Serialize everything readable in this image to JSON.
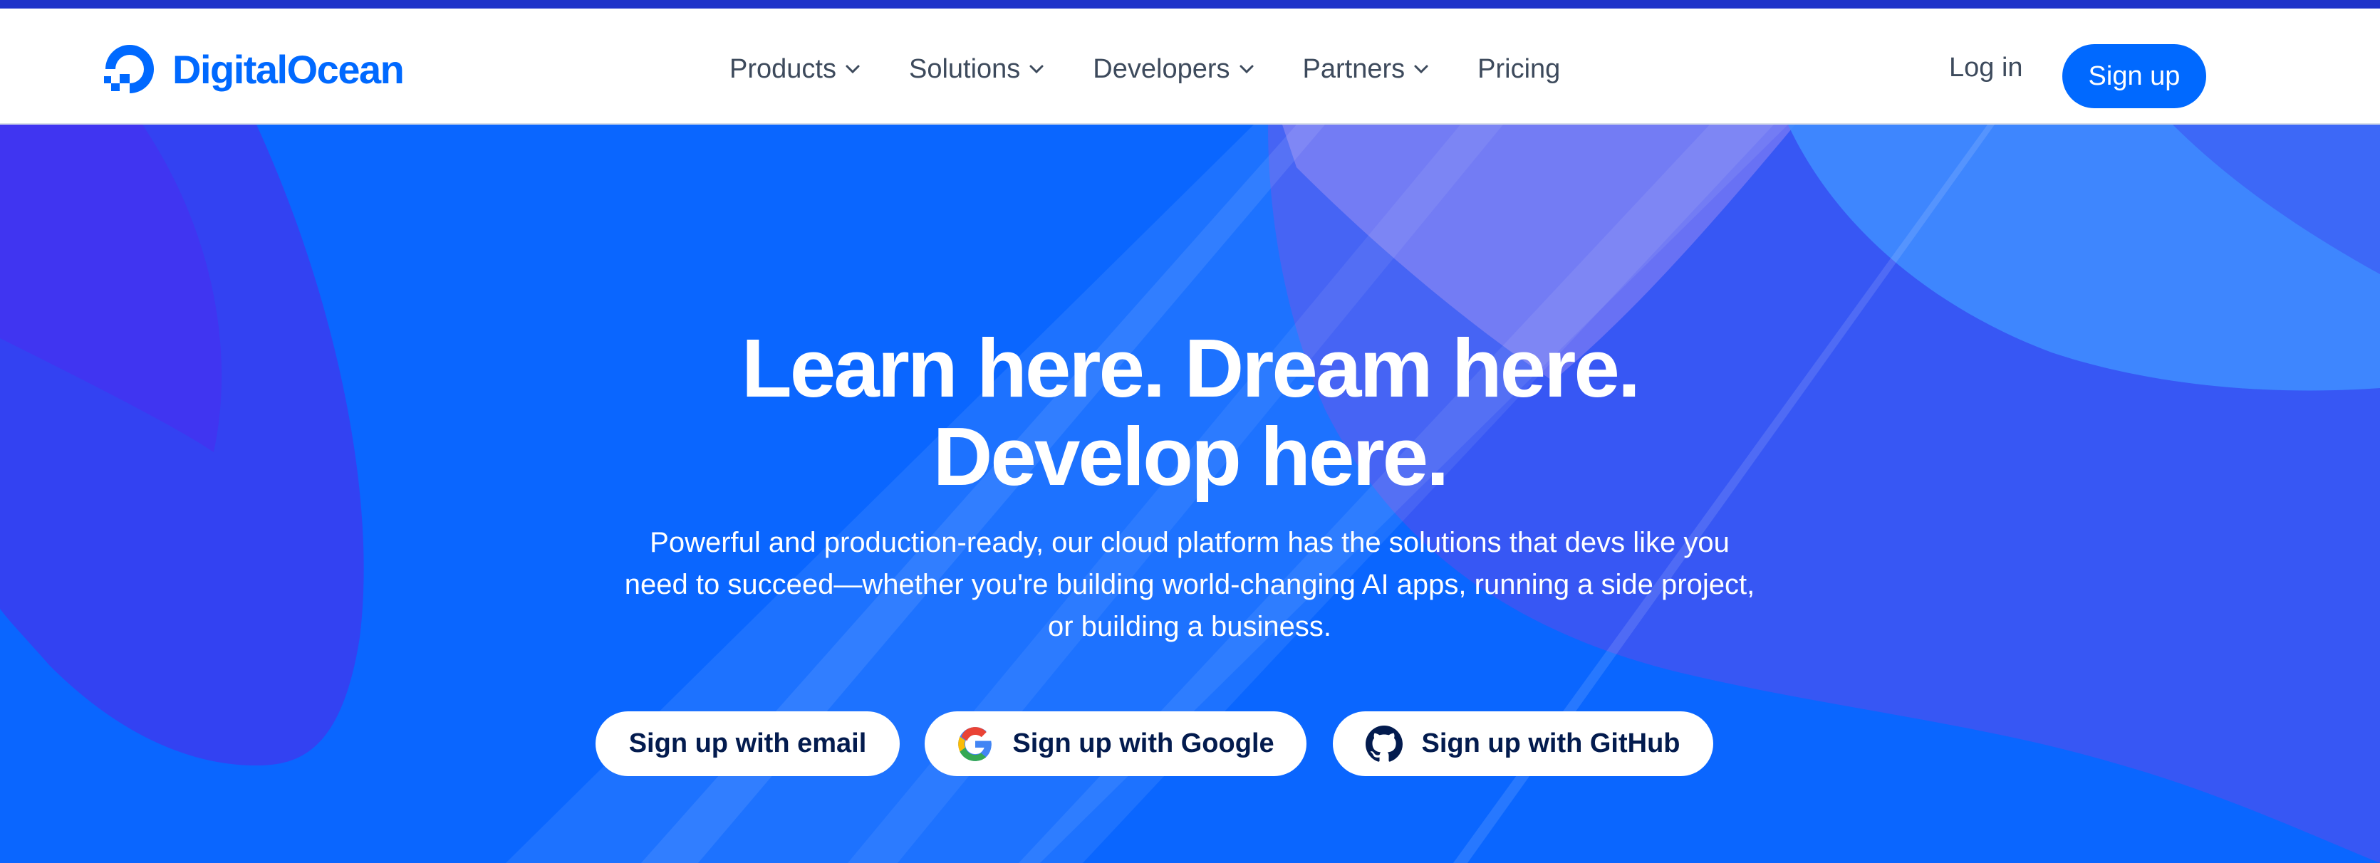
{
  "brand": {
    "name": "DigitalOcean",
    "color": "#0069ff"
  },
  "nav": {
    "items": [
      {
        "label": "Products",
        "has_dropdown": true
      },
      {
        "label": "Solutions",
        "has_dropdown": true
      },
      {
        "label": "Developers",
        "has_dropdown": true
      },
      {
        "label": "Partners",
        "has_dropdown": true
      },
      {
        "label": "Pricing",
        "has_dropdown": false
      }
    ],
    "login_label": "Log in",
    "signup_label": "Sign up"
  },
  "hero": {
    "title_line1": "Learn here. Dream here.",
    "title_line2": "Develop here.",
    "subtitle": "Powerful and production-ready, our cloud platform has the solutions that devs like you need to succeed—whether you're building world-changing AI apps, running a side project, or building a business.",
    "buttons": {
      "email": "Sign up with email",
      "google": "Sign up with Google",
      "github": "Sign up with GitHub"
    }
  },
  "icons": [
    "digitalocean-logo-icon",
    "chevron-down-icon",
    "google-icon",
    "github-icon"
  ],
  "colors": {
    "accent_stripe": "#1f33c9",
    "hero_blue": "#0069ff",
    "nav_text": "#3d4a5c",
    "cta_text": "#031b4e"
  }
}
